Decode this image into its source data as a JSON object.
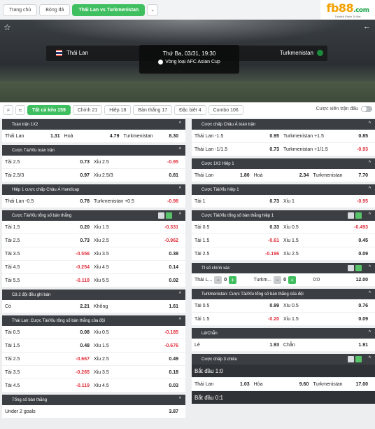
{
  "breadcrumbs": [
    "Trang chủ",
    "Bóng đá",
    "Thái Lan vs Turkmenistan"
  ],
  "logo": {
    "brand_a": "fb",
    "brand_b": "88",
    "brand_c": ".com",
    "tagline": "Trusted Place To Bet"
  },
  "match": {
    "home": "Thái Lan",
    "away": "Turkmenistan",
    "datetime": "Thứ Ba, 03/31, 19:30",
    "league": "Vòng loại AFC Asian Cup"
  },
  "tabs": [
    "Tất cả kèo 159",
    "Chính 21",
    "Hiệp 18",
    "Bàn thắng 17",
    "Đặc biệt 4",
    "Combo 106"
  ],
  "toggle_label": "Cược xiên trận đấu",
  "colors": {
    "accent": "#3fbf5f",
    "negative": "#e0303c",
    "panel_header": "#3b3f44"
  },
  "left": [
    {
      "title": "Toàn trận 1X2",
      "rows": [
        [
          [
            "Thái Lan",
            "1.31"
          ],
          [
            "Hoà",
            "4.79"
          ],
          [
            "Turkmenistan",
            "8.30"
          ]
        ]
      ]
    },
    {
      "title": "Cược Tài/Xỉu toàn trận",
      "rows": [
        [
          [
            "Tài 2.5",
            "0.73"
          ],
          [
            "Xỉu 2.5",
            "-0.95"
          ]
        ],
        [
          [
            "Tài 2.5/3",
            "0.97"
          ],
          [
            "Xỉu 2.5/3",
            "0.81"
          ]
        ]
      ]
    },
    {
      "title": "Hiệp 1 cược chấp Châu Á Handicap",
      "rows": [
        [
          [
            "Thái Lan -0.5",
            "0.78"
          ],
          [
            "Turkmenistan +0.5",
            "-0.98"
          ]
        ]
      ]
    },
    {
      "title": "Cược Tài/Xỉu tổng số bàn thắng",
      "grid": true,
      "rows": [
        [
          [
            "Tài 1.5",
            "0.20"
          ],
          [
            "Xỉu 1.5",
            "-0.331"
          ]
        ],
        [
          [
            "Tài 2.5",
            "0.73"
          ],
          [
            "Xỉu 2.5",
            "-0.962"
          ]
        ],
        [
          [
            "Tài 3.5",
            "-0.556"
          ],
          [
            "Xỉu 3.5",
            "0.38"
          ]
        ],
        [
          [
            "Tài 4.5",
            "-0.254"
          ],
          [
            "Xỉu 4.5",
            "0.14"
          ]
        ],
        [
          [
            "Tài 5.5",
            "-0.118"
          ],
          [
            "Xỉu 5.5",
            "0.02"
          ]
        ]
      ]
    },
    {
      "title": "Cả 2 đội đều ghi bàn",
      "rows": [
        [
          [
            "Có",
            "2.21"
          ],
          [
            "Không",
            "1.61"
          ]
        ]
      ]
    },
    {
      "title": "Thái Lan: Cược Tài/Xỉu tổng số bàn thắng của đội",
      "rows": [
        [
          [
            "Tài 0.5",
            "0.08"
          ],
          [
            "Xỉu 0.5",
            "-0.185"
          ]
        ],
        [
          [
            "Tài 1.5",
            "0.48"
          ],
          [
            "Xỉu 1.5",
            "-0.676"
          ]
        ],
        [
          [
            "Tài 2.5",
            "-0.667"
          ],
          [
            "Xỉu 2.5",
            "0.49"
          ]
        ],
        [
          [
            "Tài 3.5",
            "-0.265"
          ],
          [
            "Xỉu 3.5",
            "0.18"
          ]
        ],
        [
          [
            "Tài 4.5",
            "-0.119"
          ],
          [
            "Xỉu 4.5",
            "0.03"
          ]
        ]
      ]
    },
    {
      "title": "Tổng số bàn thắng",
      "rows": [
        [
          [
            "Under 2 goals",
            "3.87"
          ]
        ]
      ]
    }
  ],
  "right": [
    {
      "title": "Cược chấp Châu Á toàn trận",
      "rows": [
        [
          [
            "Thái Lan -1.5",
            "0.95"
          ],
          [
            "Turkmenistan +1.5",
            "0.85"
          ]
        ],
        [
          [
            "Thái Lan -1/1.5",
            "0.73"
          ],
          [
            "Turkmenistan +1/1.5",
            "-0.93"
          ]
        ]
      ]
    },
    {
      "title": "Cược 1X2 Hiệp 1",
      "rows": [
        [
          [
            "Thái Lan",
            "1.80"
          ],
          [
            "Hoà",
            "2.34"
          ],
          [
            "Turkmenistan",
            "7.70"
          ]
        ]
      ]
    },
    {
      "title": "Cược Tài/Xỉu hiệp 1",
      "rows": [
        [
          [
            "Tài 1",
            "0.73"
          ],
          [
            "Xỉu 1",
            "-0.95"
          ]
        ]
      ]
    },
    {
      "title": "Cược Tài/Xỉu tổng số bàn thắng hiệp 1",
      "grid": true,
      "rows": [
        [
          [
            "Tài 0.5",
            "0.33"
          ],
          [
            "Xỉu 0.5",
            "-0.493"
          ]
        ],
        [
          [
            "Tài 1.5",
            "-0.61"
          ],
          [
            "Xỉu 1.5",
            "0.45"
          ]
        ],
        [
          [
            "Tài 2.5",
            "-0.196"
          ],
          [
            "Xỉu 2.5",
            "0.09"
          ]
        ]
      ]
    },
    {
      "title": "Tỉ số chính xác",
      "grid": true,
      "score": {
        "home": "Thái L...",
        "home_val": "0",
        "away": "Turkm...",
        "away_val": "0",
        "result": "0:0",
        "odds": "12.00"
      }
    },
    {
      "title": "Turkmenistan: Cược Tài/Xỉu tổng số bàn thắng của đội",
      "rows": [
        [
          [
            "Tài 0.5",
            "0.99"
          ],
          [
            "Xỉu 0.5",
            "0.76"
          ]
        ],
        [
          [
            "Tài 1.5",
            "-0.20"
          ],
          [
            "Xỉu 1.5",
            "0.09"
          ]
        ]
      ]
    },
    {
      "title": "Lẻ/Chẵn",
      "rows": [
        [
          [
            "Lẻ",
            "1.93"
          ],
          [
            "Chẵn",
            "1.91"
          ]
        ]
      ]
    },
    {
      "title": "Cược chấp 3 chiều",
      "grid": true,
      "sections": [
        {
          "label": "Bắt đầu 1:0",
          "rows": [
            [
              [
                "Thái Lan",
                "1.03"
              ],
              [
                "Hòa",
                "9.60"
              ],
              [
                "Turkmenistan",
                "17.00"
              ]
            ]
          ]
        },
        {
          "label": "Bắt đầu 0:1",
          "rows": []
        }
      ]
    }
  ]
}
